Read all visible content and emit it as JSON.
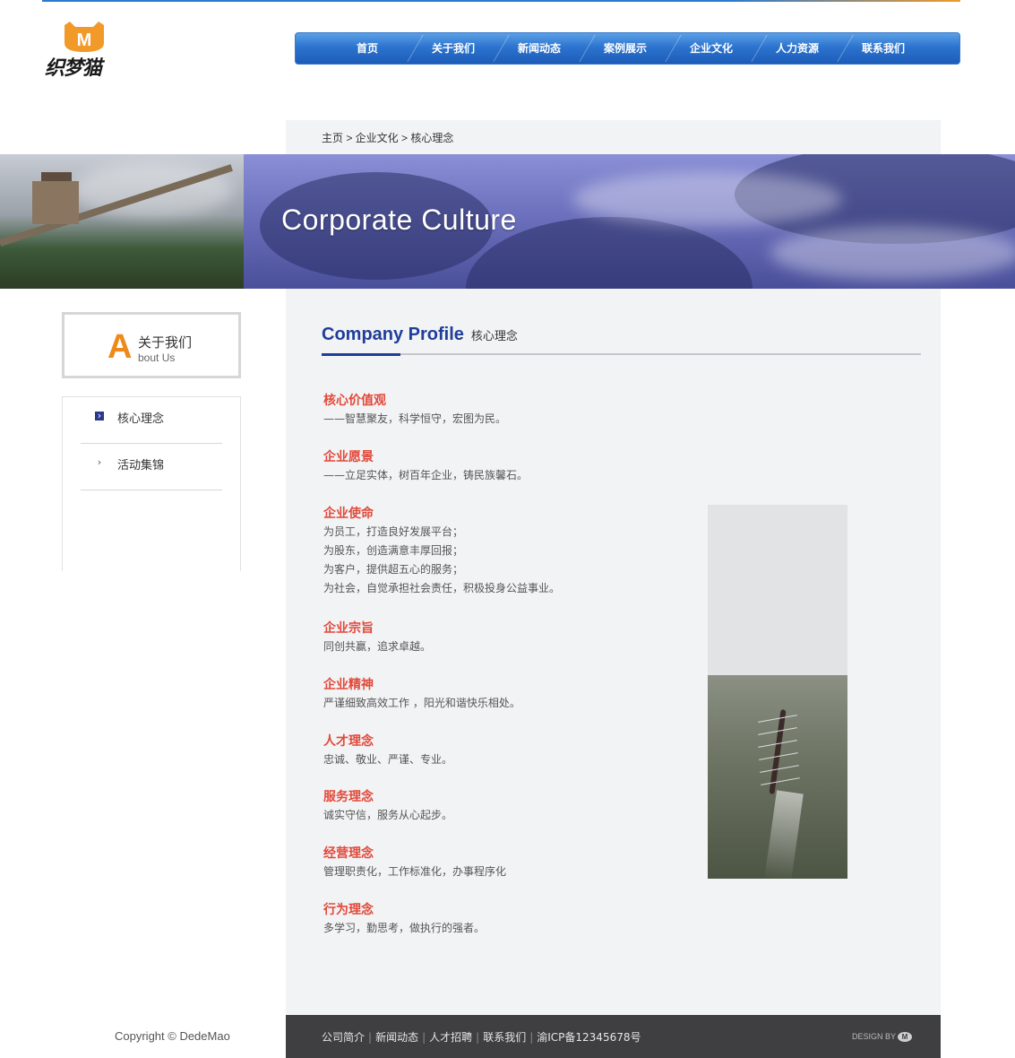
{
  "site": {
    "logo_text": "织梦猫",
    "logo_badge": "M"
  },
  "nav": {
    "items": [
      "首页",
      "关于我们",
      "新闻动态",
      "案例展示",
      "企业文化",
      "人力资源",
      "联系我们"
    ]
  },
  "breadcrumb": {
    "text": "主页 > 企业文化 > 核心理念"
  },
  "banner": {
    "title": "Corporate Culture"
  },
  "sidebar": {
    "about_letter": "A",
    "about_cn": "关于我们",
    "about_en": "bout Us",
    "items": [
      {
        "label": "核心理念",
        "arrow": "›",
        "active": true
      },
      {
        "label": "活动集锦",
        "arrow": "›",
        "active": false
      }
    ]
  },
  "main": {
    "heading_en": "Company Profile",
    "heading_cn": "核心理念",
    "sections": [
      {
        "title": "核心价值观",
        "lines": [
          "——智慧聚友，科学恒守，宏图为民。"
        ]
      },
      {
        "title": "企业愿景",
        "lines": [
          "——立足实体，树百年企业，铸民族馨石。"
        ]
      },
      {
        "title": "企业使命",
        "lines": [
          "为员工，打造良好发展平台；",
          "为股东，创造满意丰厚回报；",
          "为客户，提供超五心的服务；",
          "为社会，自觉承担社会责任，积极投身公益事业。"
        ]
      },
      {
        "title": "企业宗旨",
        "lines": [
          "同创共赢，追求卓越。"
        ]
      },
      {
        "title": "企业精神",
        "lines": [
          "严谨细致高效工作 ，阳光和谐快乐相处。"
        ]
      },
      {
        "title": "人才理念",
        "lines": [
          "忠诚、敬业、严谨、专业。"
        ]
      },
      {
        "title": "服务理念",
        "lines": [
          "诚实守信，服务从心起步。"
        ]
      },
      {
        "title": "经营理念",
        "lines": [
          "管理职责化，工作标准化，办事程序化"
        ]
      },
      {
        "title": "行为理念",
        "lines": [
          "多学习，勤思考，做执行的强者。"
        ]
      }
    ]
  },
  "footer": {
    "copyright": "Copyright © DedeMao",
    "links": [
      "公司简介",
      "新闻动态",
      "人才招聘",
      "联系我们",
      "渝ICP备12345678号"
    ],
    "design_by": "DESIGN BY",
    "design_logo": "M"
  },
  "colors": {
    "accent_blue": "#1f3d9a",
    "section_red": "#e1493a",
    "about_orange": "#ee8a1b",
    "nav_blue": "#2c74cf"
  }
}
